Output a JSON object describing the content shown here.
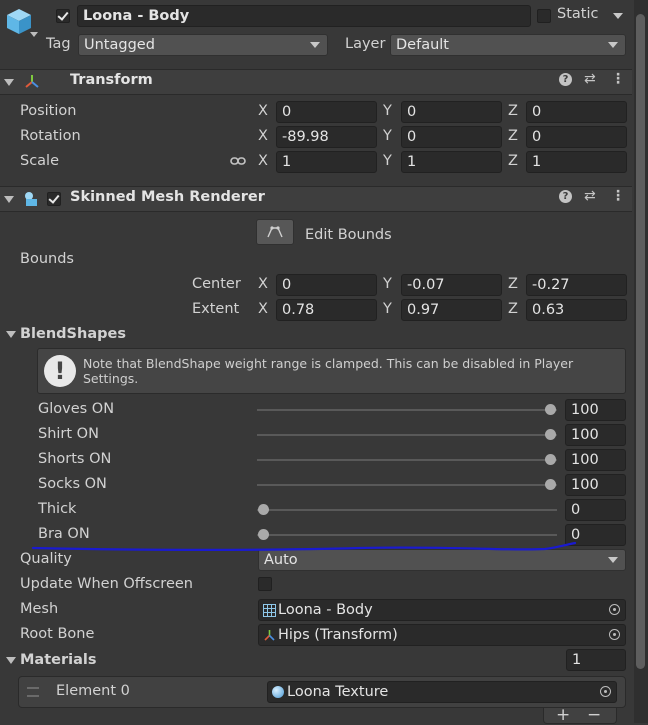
{
  "header": {
    "object_name": "Loona - Body",
    "static_label": "Static",
    "tag_label": "Tag",
    "tag_value": "Untagged",
    "layer_label": "Layer",
    "layer_value": "Default"
  },
  "transform": {
    "title": "Transform",
    "rows": [
      {
        "label": "Position",
        "x": "0",
        "y": "0",
        "z": "0"
      },
      {
        "label": "Rotation",
        "x": "-89.98",
        "y": "0",
        "z": "0"
      },
      {
        "label": "Scale",
        "x": "1",
        "y": "1",
        "z": "1"
      }
    ]
  },
  "axes": {
    "x": "X",
    "y": "Y",
    "z": "Z"
  },
  "renderer": {
    "title": "Skinned Mesh Renderer",
    "edit_bounds_label": "Edit Bounds",
    "bounds_label": "Bounds",
    "center": {
      "label": "Center",
      "x": "0",
      "y": "-0.07",
      "z": "-0.27"
    },
    "extent": {
      "label": "Extent",
      "x": "0.78",
      "y": "0.97",
      "z": "0.63"
    },
    "blendshapes_label": "BlendShapes",
    "note": "Note that BlendShape weight range is clamped. This can be disabled in Player Settings.",
    "blendshapes": [
      {
        "name": "Gloves ON",
        "value": "100",
        "fraction": 1.0
      },
      {
        "name": "Shirt ON",
        "value": "100",
        "fraction": 1.0
      },
      {
        "name": "Shorts ON",
        "value": "100",
        "fraction": 1.0
      },
      {
        "name": "Socks ON",
        "value": "100",
        "fraction": 1.0
      },
      {
        "name": "Thick",
        "value": "0",
        "fraction": 0.0
      },
      {
        "name": "Bra ON",
        "value": "0",
        "fraction": 0.0
      }
    ],
    "quality_label": "Quality",
    "quality_value": "Auto",
    "update_offscreen_label": "Update When Offscreen",
    "mesh_label": "Mesh",
    "mesh_value": "Loona - Body",
    "root_bone_label": "Root Bone",
    "root_bone_value": "Hips (Transform)"
  },
  "materials": {
    "title": "Materials",
    "count": "1",
    "element_label": "Element 0",
    "element_value": "Loona Texture",
    "add_label": "+",
    "remove_label": "−"
  },
  "colors": {
    "background": "#383838",
    "annotation_line": "#1a1ad0"
  }
}
